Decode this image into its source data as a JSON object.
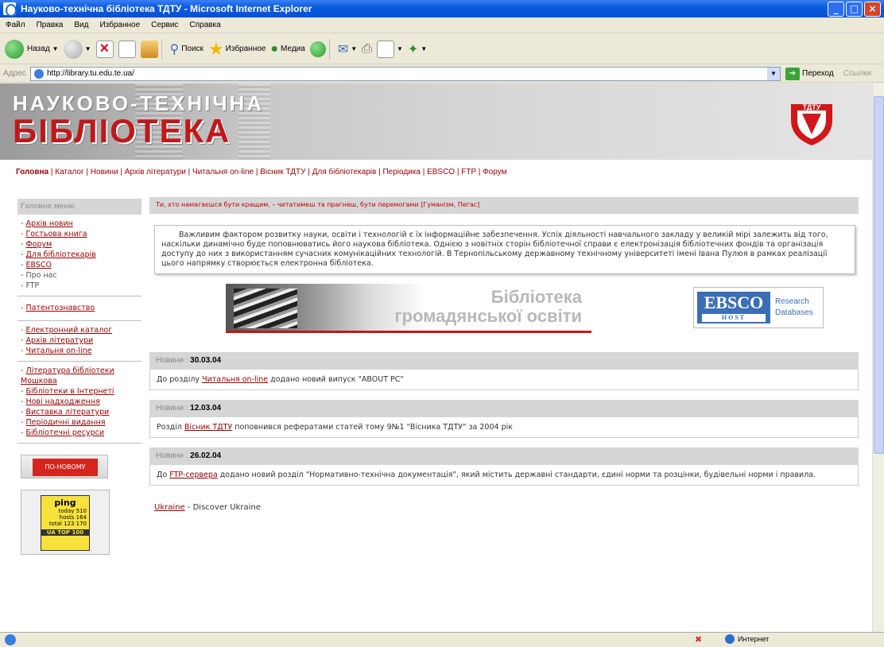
{
  "window": {
    "title": "Науково-технічна бібліотека ТДТУ - Microsoft Internet Explorer"
  },
  "menu": [
    "Файл",
    "Правка",
    "Вид",
    "Избранное",
    "Сервис",
    "Справка"
  ],
  "toolbar": {
    "back": "Назад",
    "search": "Поиск",
    "favorites": "Избранное",
    "media": "Медиа"
  },
  "address": {
    "label": "Адрес",
    "url": "http://library.tu.edu.te.ua/",
    "go": "Переход",
    "links": "Ссылки"
  },
  "banner": {
    "line1": "НАУКОВО-ТЕХНІЧНА",
    "line2": "БІБЛІОТЕКА",
    "logo_text": "ТДТУ"
  },
  "nav": {
    "active": "Головна",
    "items": [
      "Каталог",
      "Новини",
      "Архів літератури",
      "Читальня on-line",
      "Вісник ТДТУ",
      "Для бібліотекарів",
      "Періодика",
      "EBSCO",
      "FTP",
      "Форум"
    ]
  },
  "sidebar": {
    "header": "Головне меню",
    "group1": [
      "Архів новин",
      "Гостьова книга",
      "Форум",
      "Для бібліотекарів",
      "EBSCO",
      "Про нас",
      "FTP"
    ],
    "group2": [
      "Патентознавство"
    ],
    "group3": [
      "Електронний каталог",
      "Архів літератури",
      "Читальня on-line"
    ],
    "group4": [
      "Література бібліотеки Мошкова",
      "Бібліотеки в Інтернеті",
      "Нові надходження",
      "Виставка літератури",
      "Періодичні видання",
      "Бібліотечні ресурси"
    ],
    "promo": "ПО-НОВОМУ",
    "counter": {
      "name": "ping",
      "rows": [
        "today  510",
        "hosts  164",
        "total  123 170"
      ],
      "badge": "UA TOP 100"
    }
  },
  "main": {
    "notice": "Ти, хто намагаєшся бути кращим, – читатимеш та прагнеш, бути перемогами [Гуманізм, Пегас]",
    "intro": "Важливим фактором розвитку науки, освіти і технологій є їх інформаційне забезпечення. Успіх діяльності навчального закладу у великій мірі залежить від того, наскільки динамічно буде поповнюватись його наукова бібліотека. Однією з новітніх сторін бібліотечної справи є електронізація бібліотечних фондів та організація доступу до них з використанням сучасних комунікаційних технологій. В Тернопільському державному технічному університеті імені Івана Пулюя в рамках реалізації цього напрямку створюється електронна бібліотека.",
    "bgo_line1": "Бібліотека",
    "bgo_line2": "громадянської освіти",
    "ebsco_logo": "EBSCO",
    "ebsco_host": "HOST",
    "ebsco_r1": "Research",
    "ebsco_r2": "Databases",
    "news": [
      {
        "label": "Новини",
        "date": "30.03.04",
        "pre": "До розділу ",
        "link": "Читальня on-line",
        "post": " додано новий випуск \"ABOUT PC\""
      },
      {
        "label": "Новини",
        "date": "12.03.04",
        "pre": "Розділ ",
        "link": "Вісник ТДТУ",
        "post": " поповнився рефератами статей тому 9№1 \"Вісника ТДТУ\" за 2004 рік"
      },
      {
        "label": "Новини",
        "date": "26.02.04",
        "pre": "До ",
        "link": "FTP-сервера",
        "post": " додано новий розділ \"Нормативно-технічна документація\", який містить державні стандарти, єдині норми та розцінки, будівельні норми і правила."
      }
    ],
    "footer_link": "Ukraine",
    "footer_text": " - Discover Ukraine"
  },
  "status": {
    "zone": "Интернет"
  },
  "colors": {
    "accent": "#990000",
    "banner_red": "#c0181a",
    "xp_blue": "#0a5ce0"
  }
}
